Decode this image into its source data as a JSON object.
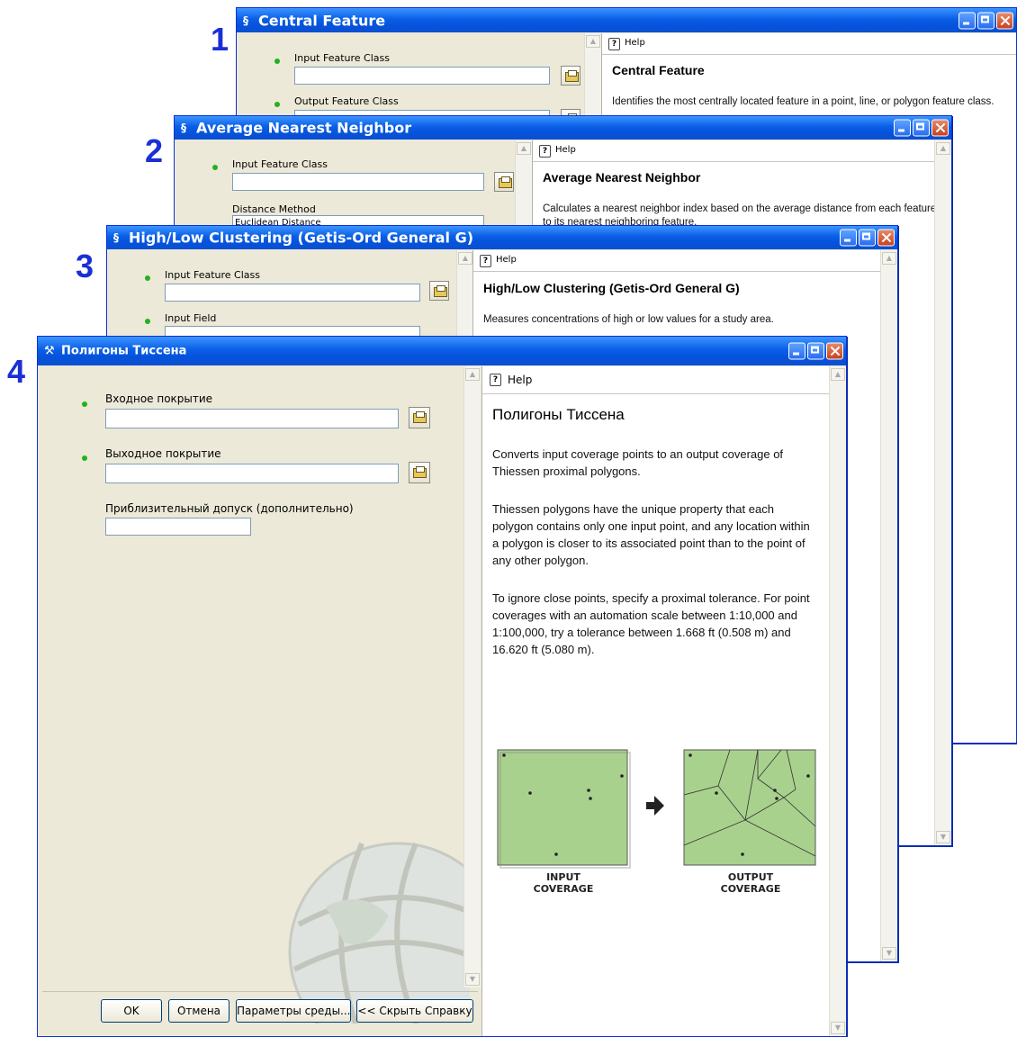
{
  "labels": [
    "1",
    "2",
    "3",
    "4"
  ],
  "window_controls": {
    "minimize": "minimize-icon",
    "maximize": "maximize-icon",
    "close": "close-icon"
  },
  "w1": {
    "title": "Central Feature",
    "fields": [
      "Input Feature Class",
      "Output Feature Class"
    ],
    "help_button": "Help",
    "help_title": "Central Feature",
    "help_text": "Identifies the most centrally located feature in a point, line, or polygon feature class."
  },
  "w2": {
    "title": "Average Nearest Neighbor",
    "fields": [
      "Input Feature Class",
      "Distance Method"
    ],
    "distance_value": "Euclidean Distance",
    "help_button": "Help",
    "help_title": "Average Nearest Neighbor",
    "help_text": "Calculates a nearest neighbor index based on the average distance from each feature to its nearest neighboring feature."
  },
  "w3": {
    "title": "High/Low Clustering (Getis-Ord General G)",
    "fields": [
      "Input Feature Class",
      "Input Field"
    ],
    "help_button": "Help",
    "help_title": "High/Low Clustering (Getis-Ord General G)",
    "help_text": "Measures concentrations of high or low values for a study area."
  },
  "w4": {
    "title": "Полигоны Тиссена",
    "fields": [
      "Входное покрытие",
      "Выходное покрытие",
      "Приблизительный допуск (дополнительно)"
    ],
    "buttons": [
      "OK",
      "Отмена",
      "Параметры среды...",
      "<< Скрыть Справку"
    ],
    "help_button": "Help",
    "help_title": "Полигоны Тиссена",
    "help_paragraphs": [
      "Converts input coverage points to an output coverage of Thiessen proximal polygons.",
      "Thiessen polygons have the unique property that each polygon contains only one input point, and any location within a polygon is closer to its associated point than to the point of any other polygon.",
      "To ignore close points, specify a proximal tolerance. For point coverages with an automation scale between 1:10,000 and 1:100,000, try a tolerance between 1.668 ft (0.508 m) and 16.620 ft (5.080 m)."
    ],
    "diagram": {
      "input_caption": [
        "INPUT",
        "COVERAGE"
      ],
      "output_caption": [
        "OUTPUT",
        "COVERAGE"
      ],
      "fill": "#a9d18e",
      "arrow": "right-arrow-icon"
    }
  }
}
